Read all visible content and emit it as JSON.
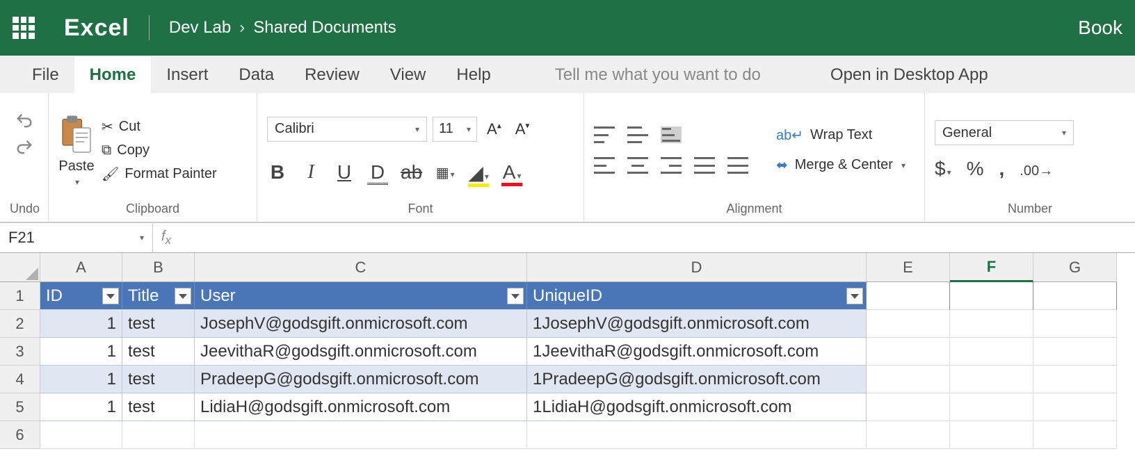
{
  "app": {
    "name": "Excel",
    "doc_title": "Book"
  },
  "breadcrumb": {
    "site": "Dev Lab",
    "library": "Shared Documents"
  },
  "tabs": {
    "file": "File",
    "home": "Home",
    "insert": "Insert",
    "data": "Data",
    "review": "Review",
    "view": "View",
    "help": "Help",
    "tellme": "Tell me what you want to do",
    "open_desktop": "Open in Desktop App"
  },
  "ribbon": {
    "undo_label": "Undo",
    "clipboard": {
      "paste": "Paste",
      "cut": "Cut",
      "copy": "Copy",
      "format_painter": "Format Painter",
      "label": "Clipboard"
    },
    "font": {
      "name": "Calibri",
      "size": "11",
      "label": "Font"
    },
    "alignment": {
      "wrap": "Wrap Text",
      "merge": "Merge & Center",
      "label": "Alignment"
    },
    "number": {
      "format": "General",
      "label": "Number"
    }
  },
  "formula_bar": {
    "name_box": "F21",
    "formula": ""
  },
  "sheet": {
    "columns": [
      "A",
      "B",
      "C",
      "D",
      "E",
      "F",
      "G"
    ],
    "active_col": "F",
    "rows": [
      "1",
      "2",
      "3",
      "4",
      "5",
      "6"
    ],
    "headers": {
      "A": "ID",
      "B": "Title",
      "C": "User",
      "D": "UniqueID"
    },
    "data": [
      {
        "A": "1",
        "B": "test",
        "C": "JosephV@godsgift.onmicrosoft.com",
        "D": "1JosephV@godsgift.onmicrosoft.com"
      },
      {
        "A": "1",
        "B": "test",
        "C": "JeevithaR@godsgift.onmicrosoft.com",
        "D": "1JeevithaR@godsgift.onmicrosoft.com"
      },
      {
        "A": "1",
        "B": "test",
        "C": "PradeepG@godsgift.onmicrosoft.com",
        "D": "1PradeepG@godsgift.onmicrosoft.com"
      },
      {
        "A": "1",
        "B": "test",
        "C": "LidiaH@godsgift.onmicrosoft.com",
        "D": "1LidiaH@godsgift.onmicrosoft.com"
      }
    ]
  }
}
